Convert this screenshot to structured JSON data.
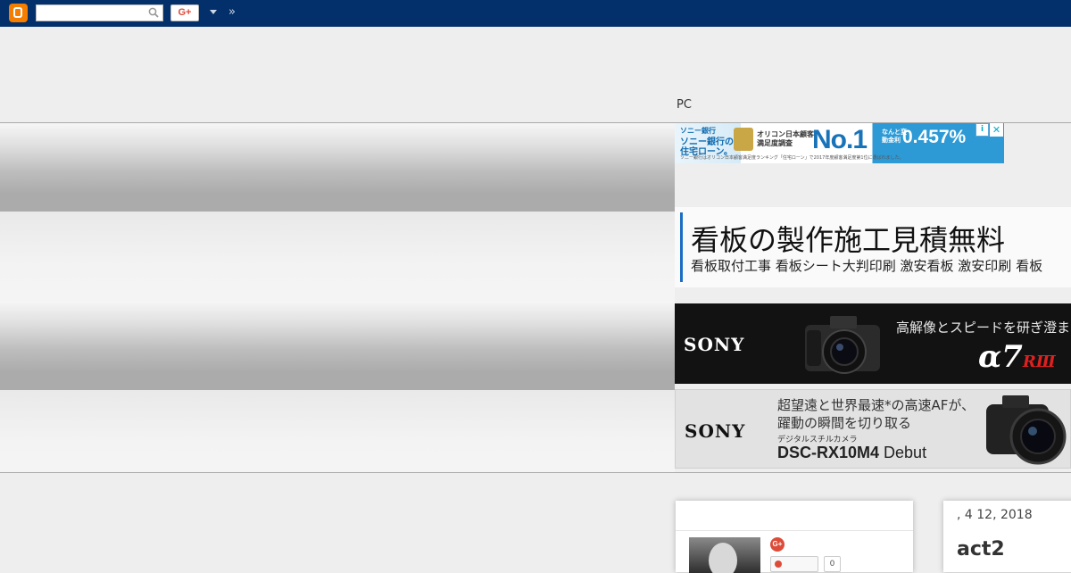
{
  "navbar": {
    "search": {
      "placeholder": ""
    },
    "gplus_label": "G+",
    "more_label": "»"
  },
  "header": {
    "pc_label": "PC"
  },
  "ads": {
    "bank": {
      "bank_name": "ソニー銀行",
      "bank_line": "ソニー銀行の住宅ローン。",
      "oricon": "オリコン日本顧客満足度調査",
      "no1": "No.1",
      "rate_small": "なんと変動金利",
      "rate": "0.457%",
      "note": "ソニー銀行はオリコン日本顧客満足度ランキング「住宅ローン」で2017年度顧客満足度第1位に選ばれました。",
      "info_icon": "i",
      "close_icon": "✕"
    },
    "sign": {
      "title": "看板の製作施工見積無料",
      "subtitle": "看板取付工事 看板シート大判印刷 激安看板 激安印刷 看板"
    },
    "sony1": {
      "brand": "SONY",
      "tagline": "高解像とスピードを研ぎ澄まし",
      "model_main": "α7",
      "model_suffix": "RⅢ"
    },
    "sony2": {
      "brand": "SONY",
      "line1": "超望遠と世界最速*の高速AFが、",
      "line2": "躍動の瞬間を切り取る",
      "line3": "デジタルスチルカメラ",
      "model": "DSC-RX10M4",
      "debut": " Debut"
    }
  },
  "profile": {
    "gplus_icon": "G+",
    "follow_count": "0"
  },
  "post": {
    "date": ", 4 12, 2018",
    "title": "act2"
  }
}
